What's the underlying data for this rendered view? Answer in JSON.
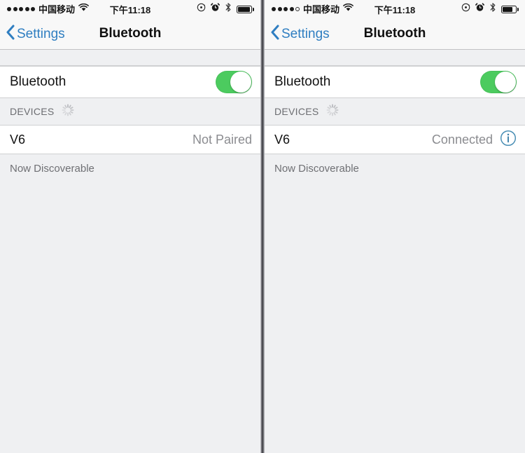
{
  "panels": [
    {
      "status_bar": {
        "signal_dots_filled": 5,
        "signal_dots_total": 5,
        "carrier": "中国移动",
        "wifi_icon": "wifi-icon",
        "time": "下午11:18",
        "rotation_lock_icon": "rotation-lock-icon",
        "alarm_icon": "alarm-clock-icon",
        "bluetooth_icon": "bluetooth-icon",
        "battery_icon": "battery-icon",
        "battery_level_percent": 92
      },
      "nav": {
        "back_icon": "chevron-left-icon",
        "back_label": "Settings",
        "title": "Bluetooth"
      },
      "bluetooth_row": {
        "label": "Bluetooth",
        "toggle_on": true,
        "toggle_name": "bluetooth-toggle"
      },
      "devices_section": {
        "header": "DEVICES",
        "spinner_icon": "activity-spinner-icon",
        "device": {
          "name": "V6",
          "status": "Not Paired",
          "has_info_button": false
        }
      },
      "footnote": "Now Discoverable"
    },
    {
      "status_bar": {
        "signal_dots_filled": 4,
        "signal_dots_total": 5,
        "carrier": "中国移动",
        "wifi_icon": "wifi-icon",
        "time": "下午11:18",
        "rotation_lock_icon": "rotation-lock-icon",
        "alarm_icon": "alarm-clock-icon",
        "bluetooth_icon": "bluetooth-icon",
        "battery_icon": "battery-icon",
        "battery_level_percent": 80
      },
      "nav": {
        "back_icon": "chevron-left-icon",
        "back_label": "Settings",
        "title": "Bluetooth"
      },
      "bluetooth_row": {
        "label": "Bluetooth",
        "toggle_on": true,
        "toggle_name": "bluetooth-toggle"
      },
      "devices_section": {
        "header": "DEVICES",
        "spinner_icon": "activity-spinner-icon",
        "device": {
          "name": "V6",
          "status": "Connected",
          "has_info_button": true,
          "info_icon": "info-circle-icon"
        }
      },
      "footnote": "Now Discoverable"
    }
  ],
  "colors": {
    "toggle_on": "#4ccb5f",
    "tint_blue": "#2f7ec1",
    "background": "#eff0f2",
    "cell": "#ffffff",
    "separator": "#cfd0d2",
    "secondary_text": "#8b8c90"
  }
}
